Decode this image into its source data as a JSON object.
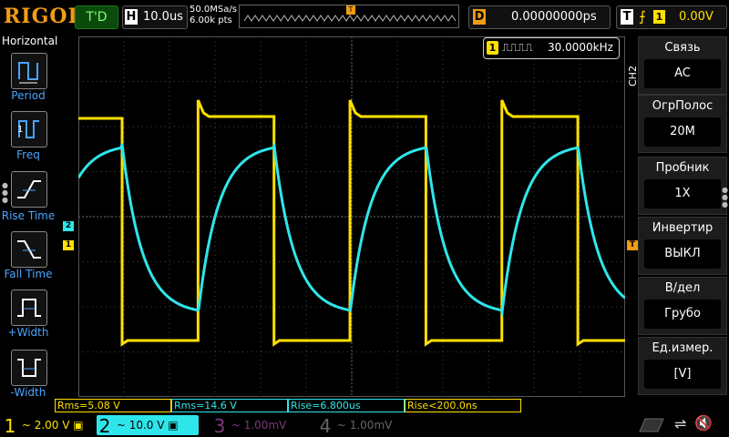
{
  "brand": {
    "logo": "RIGOL"
  },
  "header": {
    "run_state": "T'D",
    "timebase_key": "H",
    "timebase_value": "10.0us",
    "sample_rate": "50.0MSa/s",
    "memory_depth": "6.00k pts",
    "delay_key": "D",
    "delay_value": "0.00000000ps",
    "trigger_key": "T",
    "trigger_source": "1",
    "trigger_level": "0.00V"
  },
  "left_panel": {
    "title": "Horizontal",
    "items": [
      {
        "label": "Period"
      },
      {
        "label": "Freq"
      },
      {
        "label": "Rise Time"
      },
      {
        "label": "Fall Time"
      },
      {
        "label": "+Width"
      },
      {
        "label": "-Width"
      }
    ]
  },
  "freq_readout": {
    "channel": "1",
    "value": "30.0000kHz"
  },
  "markers": {
    "ch1": "1",
    "ch2": "2",
    "trigger_level": "T",
    "trigger_pos": "T"
  },
  "right_menu": {
    "channel_tag": "CH2",
    "items": [
      {
        "title": "Связь",
        "value": "AC"
      },
      {
        "title": "ОгрПолос",
        "value": "20M"
      },
      {
        "title": "Пробник",
        "value": "1X"
      },
      {
        "title": "Инвертир",
        "value": "ВЫКЛ"
      },
      {
        "title": "В/дел",
        "value": "Грубо"
      },
      {
        "title": "Ед.измер.",
        "value": "[V]"
      }
    ]
  },
  "measurements": [
    "Rms=5.08 V",
    "Rms=14.6 V",
    "Rise=6.800us",
    "Rise<200.0ns"
  ],
  "bottom": {
    "ch1": {
      "num": "1",
      "coupling": "~",
      "scale": "2.00 V"
    },
    "ch2": {
      "num": "2",
      "coupling": "~",
      "scale": "10.0 V"
    },
    "ch3": {
      "num": "3",
      "coupling": "~",
      "scale": "1.00mV"
    },
    "ch4": {
      "num": "4",
      "coupling": "~",
      "scale": "1.00mV"
    }
  },
  "colors": {
    "ch1": "#ffe000",
    "ch2": "#2ee6ea",
    "ch3": "#c84cc8",
    "ch4": "#3a7bff",
    "accent": "#f39c12",
    "menu_blue": "#4aa3ff"
  }
}
